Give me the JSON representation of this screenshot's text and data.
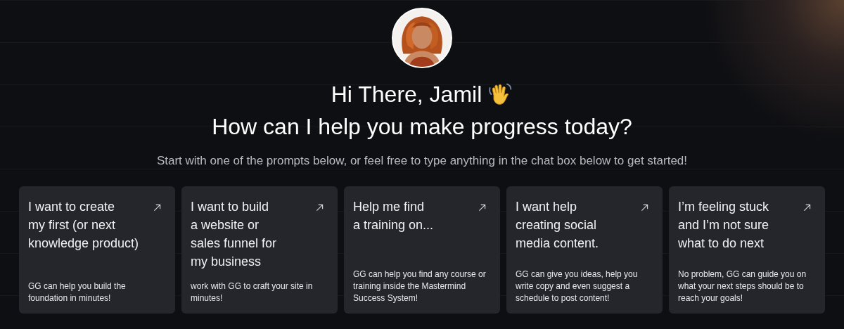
{
  "greeting": {
    "line_1": "Hi There, Jamil",
    "line_2": "How can I help you make progress today?"
  },
  "subtitle": "Start with one of the prompts below, or feel free to type anything in the chat box below to get started!",
  "prompts": [
    {
      "title_lines": [
        "I want to create",
        "my first (or next",
        "knowledge product)"
      ],
      "description": "GG can help you build the foundation in minutes!"
    },
    {
      "title_lines": [
        "I want to build",
        "a website or",
        "sales funnel for",
        "my business"
      ],
      "description": "work with GG to craft your site in minutes!"
    },
    {
      "title_lines": [
        "Help me find",
        "a training on..."
      ],
      "description": "GG can help you find any course or training inside the Mastermind Success System!"
    },
    {
      "title_lines": [
        "I want help",
        "creating social",
        "media content."
      ],
      "description": "GG can give you ideas, help you write copy and even suggest a schedule to post content!"
    },
    {
      "title_lines": [
        "I’m feeling stuck",
        "and I’m not sure",
        "what to do next"
      ],
      "description": "No problem, GG can guide you on what your next steps should be to reach your goals!"
    }
  ]
}
